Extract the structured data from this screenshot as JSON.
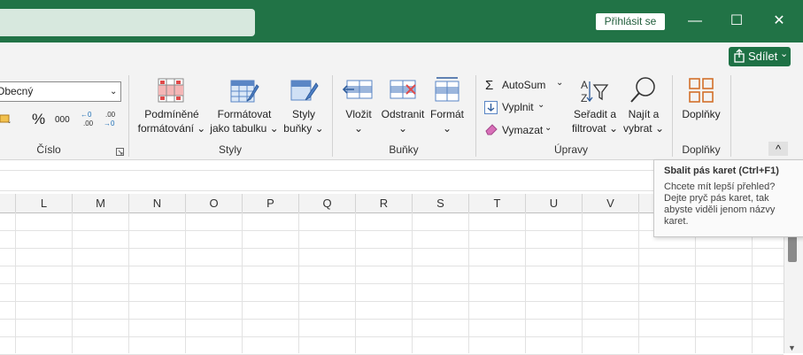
{
  "titlebar": {
    "signin_label": "Přihlásit se",
    "minimize_glyph": "—",
    "maximize_glyph": "☐",
    "close_glyph": "✕"
  },
  "share": {
    "label": "Sdílet",
    "chevron": "⌄"
  },
  "number_group": {
    "format_value": "Obecný",
    "percent_glyph": "%",
    "thousands_glyph": "000",
    "dec_increase": "←0\n.00",
    "dec_decrease": ".00\n→0",
    "group_label": "Číslo"
  },
  "styles_group": {
    "conditional_line1": "Podmíněné",
    "conditional_line2": "formátování ⌄",
    "table_line1": "Formátovat",
    "table_line2": "jako tabulku ⌄",
    "cellstyles_line1": "Styly",
    "cellstyles_line2": "buňky ⌄",
    "group_label": "Styly"
  },
  "cells_group": {
    "insert": "Vložit",
    "delete": "Odstranit",
    "format": "Formát",
    "chevron": "⌄",
    "group_label": "Buňky"
  },
  "editing_group": {
    "autosum": "AutoSum",
    "fill": "Vyplnit",
    "clear": "Vymazat",
    "sort_line1": "Seřadit a",
    "sort_line2": "filtrovat ⌄",
    "find_line1": "Najít a",
    "find_line2": "vybrat ⌄",
    "group_label": "Úpravy"
  },
  "addins_group": {
    "addins": "Doplňky",
    "group_label": "Doplňky"
  },
  "collapse_glyph": "^",
  "tooltip": {
    "title": "Sbalit pás karet (Ctrl+F1)",
    "body": "Chcete mít lepší přehled? Dejte pryč pás karet, tak abyste viděli jenom názvy karet."
  },
  "columns": [
    "L",
    "M",
    "N",
    "O",
    "P",
    "Q",
    "R",
    "S",
    "T",
    "U",
    "V"
  ],
  "colors": {
    "brand_green": "#217346",
    "ribbon_bg": "#f3f3f3"
  }
}
